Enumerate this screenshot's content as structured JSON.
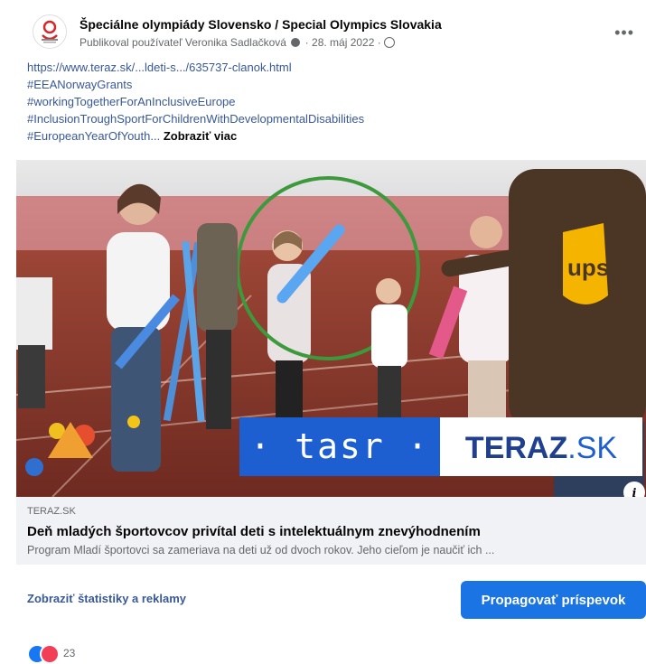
{
  "post": {
    "page_name": "Špeciálne olympiády Slovensko / Special Olympics Slovakia",
    "meta": "Publikoval používateľ Veronika Sadlačková",
    "date": "28. máj 2022",
    "more_icon": "more-options-icon",
    "text_lines": [
      "https://www.teraz.sk/...ldeti-s.../635737-clanok.html",
      "#EEANorwayGrants",
      "#workingTogetherForAnInclusiveEurope",
      "#InclusionTroughSportForChildrenWithDevelopmentalDisabilities"
    ],
    "last_line": "#EuropeanYearOfYouth...",
    "see_more": "Zobraziť viac"
  },
  "media": {
    "tasr_logo": "tasr",
    "teraz_logo_main": "TERAZ",
    "teraz_logo_suffix": ".SK",
    "shirt_logo": "ups"
  },
  "link_preview": {
    "domain": "TERAZ.SK",
    "title": "Deň mladých športovcov privítal deti s intelektuálnym znevýhodnením",
    "description": "Program Mladí športovci sa zameriava na deti už od dvoch rokov. Jeho cieľom je naučiť ich ..."
  },
  "actions": {
    "stats_link": "Zobraziť štatistiky a reklamy",
    "promote_button": "Propagovať príspevok"
  },
  "reactions": {
    "count": "23"
  },
  "colors": {
    "link": "#385898",
    "button": "#1b74e4",
    "tasr_blue": "#1d5fd1"
  }
}
